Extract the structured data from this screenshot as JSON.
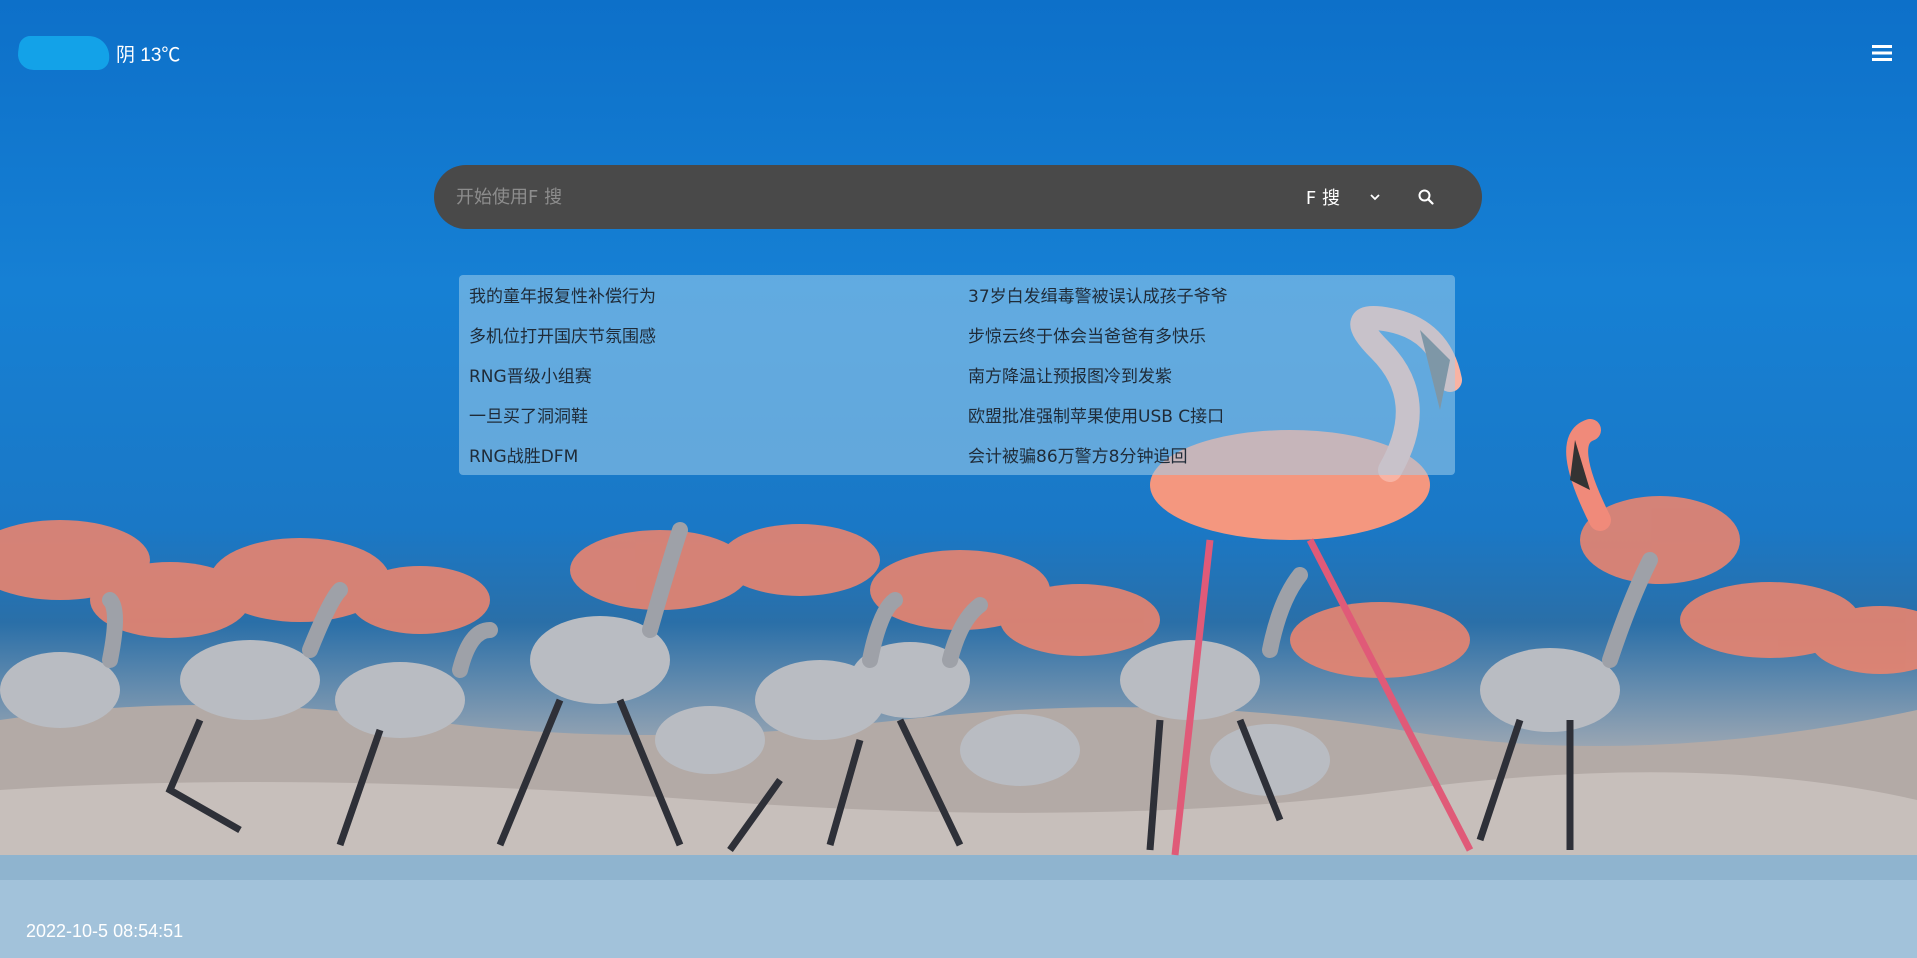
{
  "weather": {
    "city_icon": "blurred-city-name",
    "text": "阴 13℃"
  },
  "header": {
    "menu_icon": "hamburger-menu-icon"
  },
  "search": {
    "placeholder": "开始使用F 搜",
    "engine_label": "F 搜",
    "dropdown_icon": "chevron-down-icon",
    "submit_icon": "search-icon"
  },
  "hot_searches": {
    "left": [
      "我的童年报复性补偿行为",
      "多机位打开国庆节氛围感",
      "RNG晋级小组赛",
      "一旦买了洞洞鞋",
      "RNG战胜DFM"
    ],
    "right": [
      "37岁白发缉毒警被误认成孩子爷爷",
      "步惊云终于体会当爸爸有多快乐",
      "南方降温让预报图冷到发紫",
      "欧盟批准强制苹果使用USB C接口",
      "会计被骗86万警方8分钟追回"
    ]
  },
  "clock": {
    "datetime": "2022-10-5 08:54:51"
  },
  "colors": {
    "sky": "#1680d4",
    "search_bar": "#494949",
    "flamingo": "#f08a7a",
    "chick": "#b9bcc2"
  }
}
